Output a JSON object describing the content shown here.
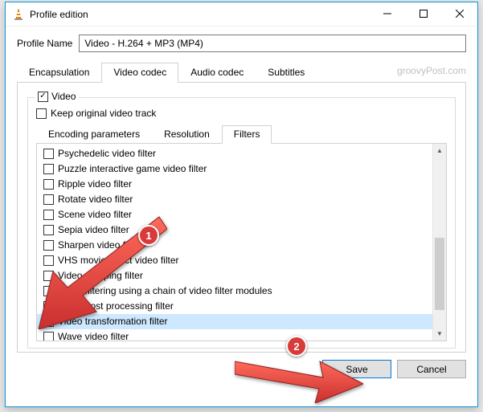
{
  "window": {
    "title": "Profile edition"
  },
  "profile": {
    "label": "Profile Name",
    "value": "Video - H.264 + MP3 (MP4)"
  },
  "watermark": "groovyPost.com",
  "tabs": [
    {
      "label": "Encapsulation"
    },
    {
      "label": "Video codec"
    },
    {
      "label": "Audio codec"
    },
    {
      "label": "Subtitles"
    }
  ],
  "video": {
    "legend": "Video",
    "keep_original": "Keep original video track"
  },
  "inner_tabs": [
    {
      "label": "Encoding parameters"
    },
    {
      "label": "Resolution"
    },
    {
      "label": "Filters"
    }
  ],
  "filters": [
    {
      "label": "Psychedelic video filter",
      "checked": false
    },
    {
      "label": "Puzzle interactive game video filter",
      "checked": false
    },
    {
      "label": "Ripple video filter",
      "checked": false
    },
    {
      "label": "Rotate video filter",
      "checked": false
    },
    {
      "label": "Scene video filter",
      "checked": false
    },
    {
      "label": "Sepia video filter",
      "checked": false
    },
    {
      "label": "Sharpen video filter",
      "checked": false
    },
    {
      "label": "VHS movie effect video filter",
      "checked": false
    },
    {
      "label": "Video cropping filter",
      "checked": false
    },
    {
      "label": "Video filtering using a chain of video filter modules",
      "checked": false
    },
    {
      "label": "Video post processing filter",
      "checked": false
    },
    {
      "label": "Video transformation filter",
      "checked": true,
      "selected": true
    },
    {
      "label": "Wave video filter",
      "checked": false
    }
  ],
  "buttons": {
    "save": "Save",
    "cancel": "Cancel"
  },
  "annotations": {
    "badge1": "1",
    "badge2": "2"
  }
}
